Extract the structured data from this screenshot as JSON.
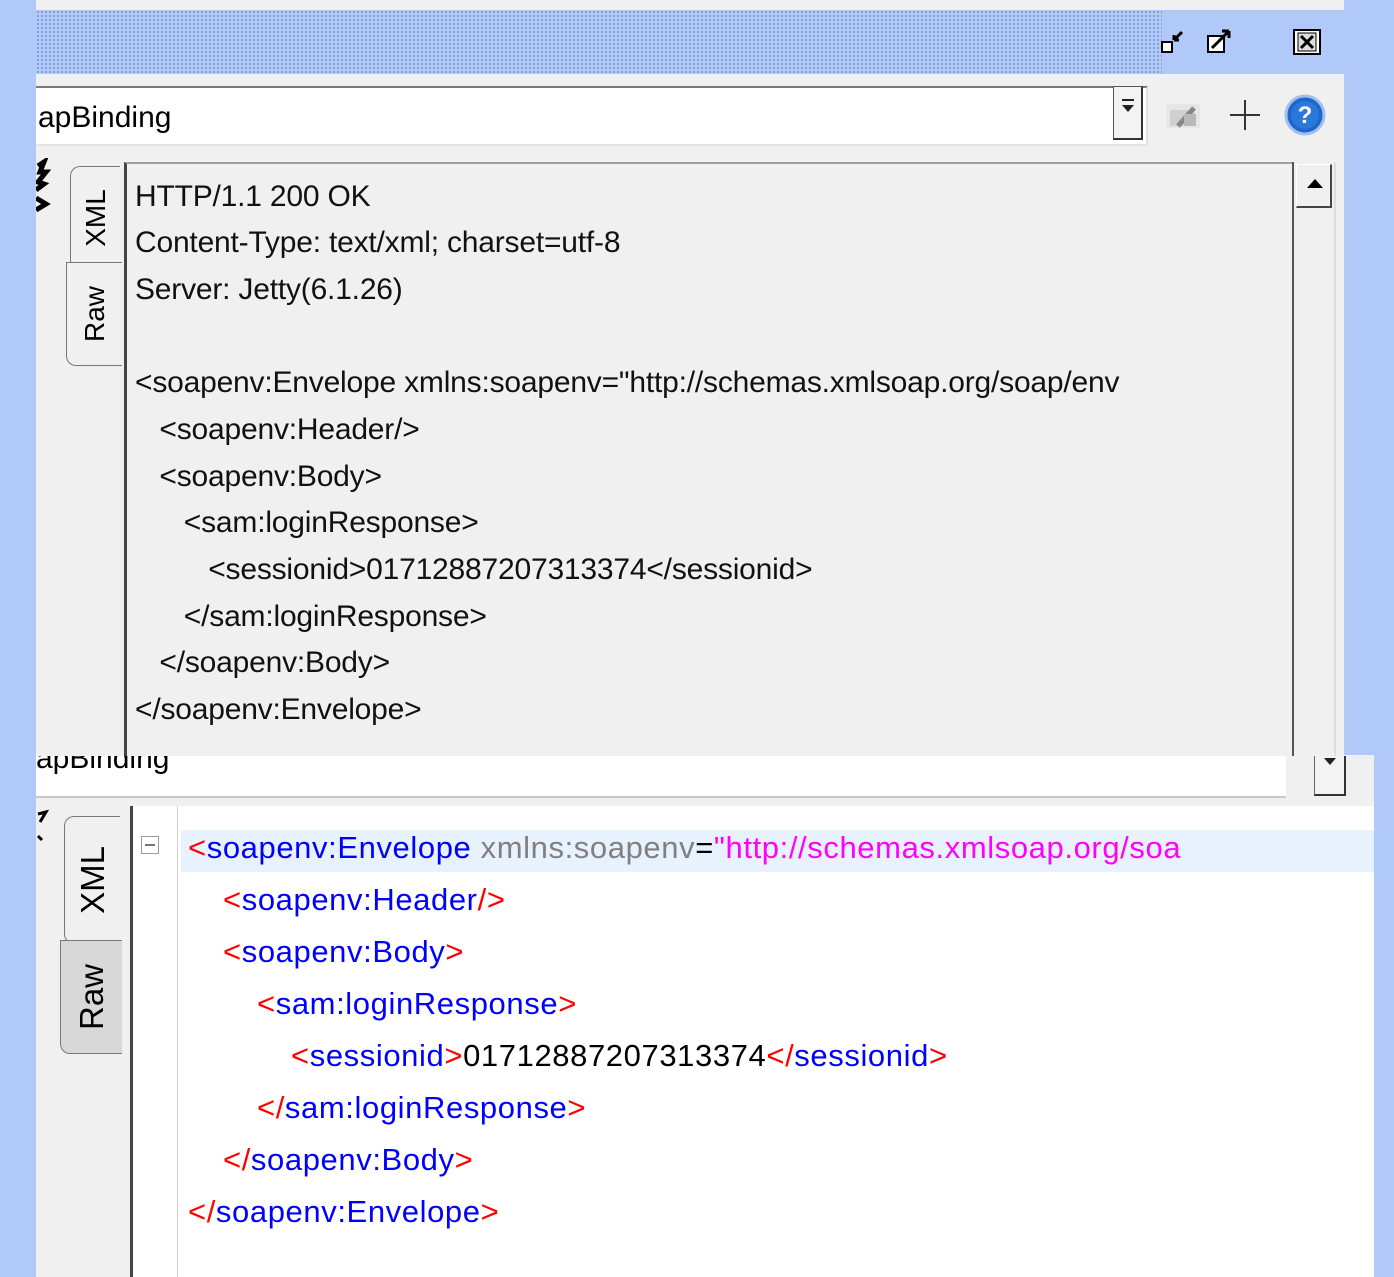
{
  "window": {
    "buttons": {
      "restore": "restore-icon",
      "maximize": "maximize-icon",
      "close": "close-icon"
    }
  },
  "top_combo": {
    "value": "apBinding"
  },
  "toolbar": {
    "icons": [
      "request-icon",
      "add-icon",
      "help-icon"
    ]
  },
  "top_panel": {
    "tabs": [
      "XML",
      "Raw"
    ],
    "raw_lines": [
      "HTTP/1.1 200 OK",
      "Content-Type: text/xml; charset=utf-8",
      "Server: Jetty(6.1.26)",
      "",
      "<soapenv:Envelope xmlns:soapenv=\"http://schemas.xmlsoap.org/soap/env",
      "   <soapenv:Header/>",
      "   <soapenv:Body>",
      "      <sam:loginResponse>",
      "         <sessionid>01712887207313374</sessionid>",
      "      </sam:loginResponse>",
      "   </soapenv:Body>",
      "</soapenv:Envelope>"
    ]
  },
  "bottom_combo": {
    "value": "apBinding"
  },
  "bottom_panel": {
    "tabs": [
      "XML",
      "Raw"
    ],
    "xml": {
      "lt": "<",
      "gt": ">",
      "lt_slash": "</",
      "slash_gt": "/>",
      "eq": "=",
      "envelope": "soapenv:Envelope",
      "attr": "xmlns:soapenv",
      "attr_value": "\"http://schemas.xmlsoap.org/soa",
      "header": "soapenv:Header",
      "body": "soapenv:Body",
      "login": "sam:loginResponse",
      "session": "sessionid",
      "session_value": "01712887207313374"
    }
  }
}
